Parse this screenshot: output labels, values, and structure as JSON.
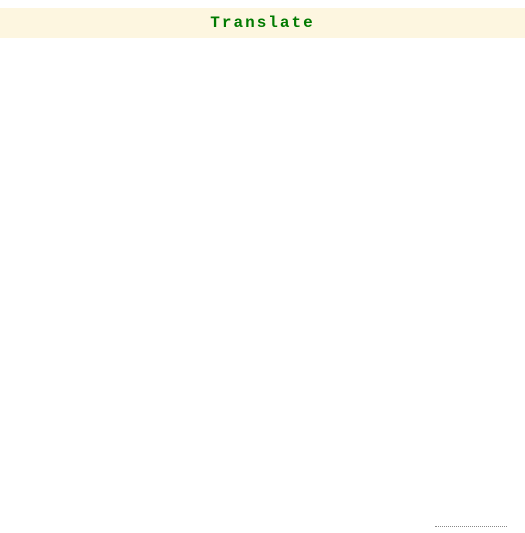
{
  "header": {
    "title": "Translate"
  }
}
